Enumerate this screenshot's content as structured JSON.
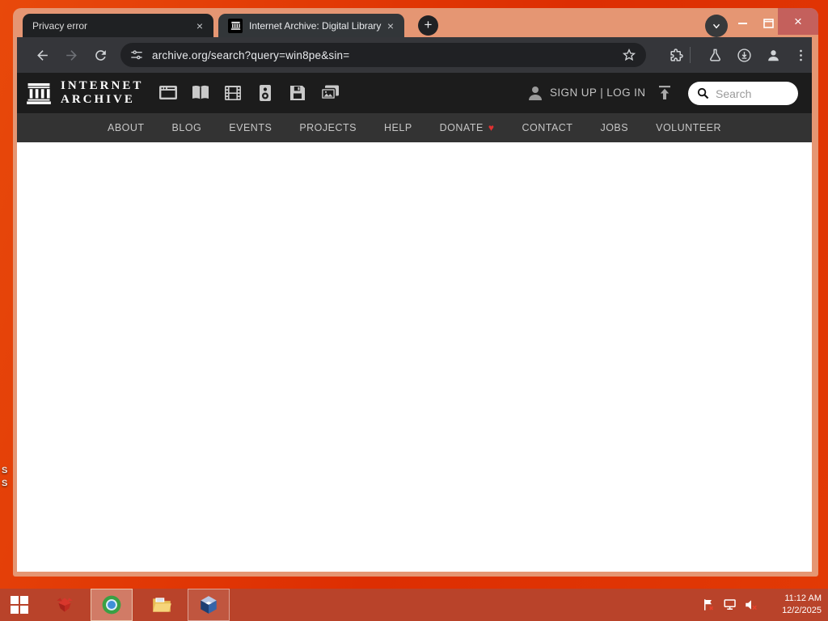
{
  "glyphs": {
    "close": "×",
    "plus": "+",
    "heart": "♥"
  },
  "window": {
    "tabs": [
      {
        "title": "Privacy error"
      },
      {
        "title": "Internet Archive: Digital Library"
      }
    ]
  },
  "toolbar": {
    "url": "archive.org/search?query=win8pe&sin="
  },
  "ia": {
    "logo": [
      "INTERNET",
      "ARCHIVE"
    ],
    "media_types": [
      "web",
      "texts",
      "video",
      "audio",
      "software",
      "images"
    ],
    "auth": "SIGN UP | LOG IN",
    "search_placeholder": "Search",
    "nav": [
      "ABOUT",
      "BLOG",
      "EVENTS",
      "PROJECTS",
      "HELP",
      "DONATE",
      "CONTACT",
      "JOBS",
      "VOLUNTEER"
    ]
  },
  "taskbar": {
    "time": "11:12 AM",
    "date": "12/2/2025"
  },
  "desktop": {
    "fragments": [
      "S",
      "S"
    ]
  },
  "colors": {
    "frame": "#e59673",
    "desktop_red": "#dd3304",
    "taskbar": "#b9432a",
    "toolbar": "#35363a",
    "header": "#1c1c1c",
    "nav": "#333333",
    "heart_red": "#e03131",
    "close_button": "#c4605c"
  }
}
